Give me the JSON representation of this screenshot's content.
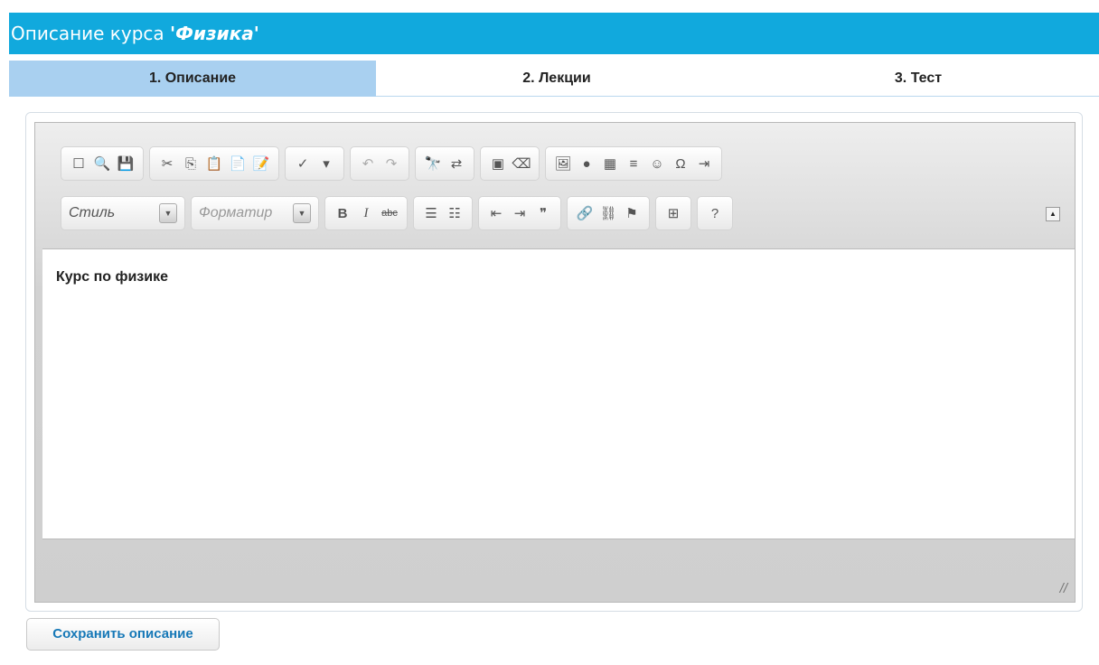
{
  "header": {
    "prefix": "Описание курса",
    "course_name": "'Физика'"
  },
  "tabs": [
    {
      "label": "1. Описание",
      "active": true
    },
    {
      "label": "2. Лекции",
      "active": false
    },
    {
      "label": "3. Тест",
      "active": false
    }
  ],
  "editor": {
    "style_placeholder": "Стиль",
    "format_placeholder": "Форматир",
    "content": "Курс по физике"
  },
  "save_button": {
    "label": "Сохранить описание"
  },
  "colors": {
    "header_bg": "#11a9dd",
    "active_tab_bg": "#a9d0f0",
    "save_text": "#1678b7"
  }
}
